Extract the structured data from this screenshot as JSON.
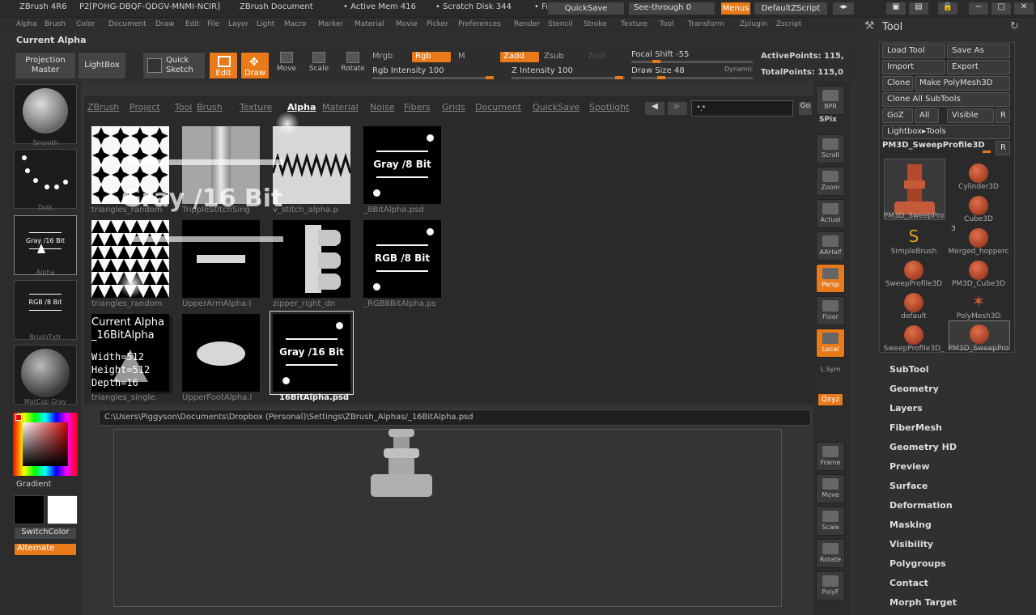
{
  "titlebar": {
    "app": "ZBrush 4R6",
    "session": "P2[POHG-DBQF-QDGV-MNMI-NCIR]",
    "doc": "ZBrush Document",
    "mem": "• Active Mem 416",
    "scratch": "• Scratch Disk 344",
    "more": "• Fr",
    "quicksave": "QuickSave",
    "seethrough": "See-through",
    "seethrough_val": "0",
    "menus": "Menus",
    "zscript": "DefaultZScript"
  },
  "menubar": [
    "Alpha",
    "Brush",
    "Color",
    "Document",
    "Draw",
    "Edit",
    "File",
    "Layer",
    "Light",
    "Macro",
    "Marker",
    "Material",
    "Movie",
    "Picker",
    "Preferences",
    "Render",
    "Stencil",
    "Stroke",
    "Texture",
    "Tool",
    "Transform",
    "Zplugin",
    "Zscript"
  ],
  "current_alpha_label": "Current Alpha",
  "shelf": {
    "projection_master": "Projection Master",
    "lightbox": "LightBox",
    "quick_sketch": "Quick Sketch",
    "edit": "Edit",
    "draw": "Draw",
    "move": "Move",
    "scale": "Scale",
    "rotate": "Rotate",
    "mrgb": "Mrgb",
    "rgb": "Rgb",
    "m": "M",
    "zadd": "Zadd",
    "zsub": "Zsub",
    "zcut": "Zcut",
    "rgb_intensity": "Rgb Intensity 100",
    "z_intensity": "Z Intensity 100",
    "focal_shift": "Focal Shift -55",
    "draw_size": "Draw Size 48",
    "dynamic": "Dynamic",
    "active_points": "ActivePoints: 115,",
    "total_points": "TotalPoints: 115,0"
  },
  "left": {
    "smooth": "Smooth",
    "dots": "Dots",
    "alpha": "Alpha",
    "alpha_thumb": "Gray /16 Bit",
    "brushtxtr": "BrushTxtr",
    "brushtxtr_thumb": "RGB /8 Bit",
    "matcap": "MatCap Gray",
    "gradient": "Gradient",
    "switchcolor": "SwitchColor",
    "alternate": "Alternate"
  },
  "popup": {
    "tabs": [
      "ZBrush",
      "Project",
      "Tool",
      "Brush",
      "Texture",
      "Alpha",
      "Material",
      "Noise",
      "Fibers",
      "Grids",
      "Document",
      "QuickSave",
      "Spotlight"
    ],
    "filter": "*.*",
    "overlay": "Gray /16 Bit",
    "items": [
      {
        "caption": "triangles_random",
        "kind": "stars"
      },
      {
        "caption": "TrippleStitchSing",
        "kind": "stitch"
      },
      {
        "caption": "v_stitch_alpha.p",
        "kind": "zigzag"
      },
      {
        "caption": "_8BitAlpha.psd",
        "kind": "label",
        "label": "Gray /8 Bit"
      },
      {
        "caption": "triangles_random",
        "kind": "triangles"
      },
      {
        "caption": "UpperArmAlpha.I",
        "kind": "bar"
      },
      {
        "caption": "zipper_right_dn",
        "kind": "zipper"
      },
      {
        "caption": "_RGB8BitAlpha.ps",
        "kind": "label",
        "label": "RGB /8 Bit"
      },
      {
        "caption": "triangles_single.",
        "kind": "tri"
      },
      {
        "caption": "UpperFootAlpha.I",
        "kind": "ellipse"
      },
      {
        "caption": "16BitAlpha.psd",
        "kind": "label",
        "label": "Gray /16 Bit"
      }
    ],
    "tooltip": {
      "name": "Current Alpha",
      "file": "_16BitAlpha",
      "width": "Width=512",
      "height": "Height=512",
      "depth": "Depth=16"
    },
    "path": "C:\\Users\\Piggyson\\Documents\\Dropbox (Personal)\\Settings\\ZBrush_Alphas/_16BitAlpha.psd"
  },
  "right": {
    "bpr": "BPR",
    "spix": "SPix",
    "scroll": "Scroll",
    "zoom": "Zoom",
    "actual": "Actual",
    "aahalf": "AAHalf",
    "persp": "Persp",
    "floor": "Floor",
    "local": "Local",
    "lsym": "L.Sym",
    "xyz": "Qxyz",
    "frame": "Frame",
    "move": "Move",
    "scale": "Scale",
    "rotate": "Rotate",
    "polyf": "PolyF"
  },
  "tool": {
    "title": "Tool",
    "load": "Load Tool",
    "save": "Save As",
    "import": "Import",
    "export": "Export",
    "clone": "Clone",
    "make_polymesh": "Make PolyMesh3D",
    "clone_all": "Clone All SubTools",
    "goz": "GoZ",
    "all": "All",
    "visible": "Visible",
    "r": "R",
    "lightbox_tools": "Lightbox▸Tools",
    "current": "PM3D_SweepProfile3D",
    "count": "3",
    "subtools": [
      "PM3D_SweepPro",
      "Cylinder3D",
      "",
      "Cube3D",
      "SimpleBrush",
      "Merged_hopperc",
      "SweepProfile3D",
      "PM3D_Cube3D",
      "default",
      "PolyMesh3D",
      "SweepProfile3D_",
      "PM3D_SweepPro"
    ],
    "menu": [
      "SubTool",
      "Geometry",
      "Layers",
      "FiberMesh",
      "Geometry HD",
      "Preview",
      "Surface",
      "Deformation",
      "Masking",
      "Visibility",
      "Polygroups",
      "Contact",
      "Morph Target"
    ]
  },
  "colors": {
    "accent": "#e87a1a"
  }
}
